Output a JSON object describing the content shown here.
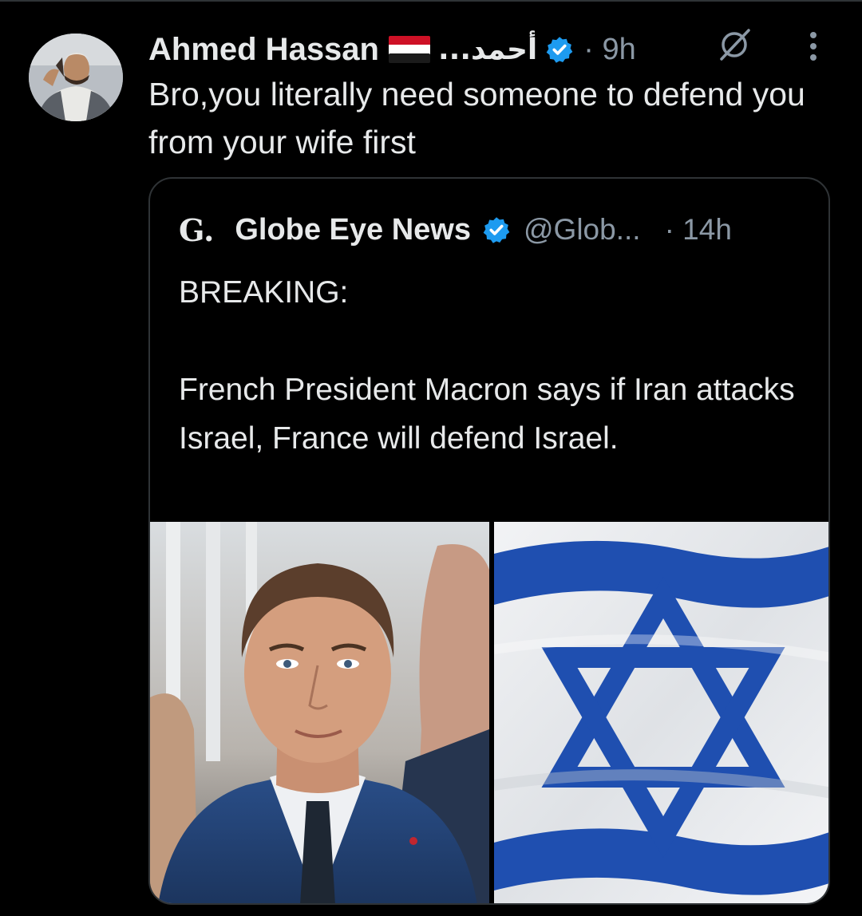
{
  "reply": {
    "author_name": "Ahmed Hassan",
    "author_arabic_name": "أحمد...",
    "flag_icon": "yemen-flag-icon",
    "verified_icon": "verified-badge-icon",
    "time": "· 9h",
    "text": "Bro,you literally need someone to defend you from your wife first"
  },
  "quoted": {
    "logo": "G.",
    "name": "Globe Eye News",
    "verified_icon": "verified-badge-icon",
    "handle": "@Glob...",
    "time": "· 14h",
    "text_lines": [
      "BREAKING:",
      "French President Macron says if Iran attacks Israel, France will defend Israel."
    ],
    "images": [
      "macron-photo",
      "israel-flag-image"
    ]
  },
  "colors": {
    "background": "#000000",
    "text": "#e7e9ea",
    "muted": "#8b98a5",
    "border": "#2f3336",
    "verified_blue": "#1d9bf0",
    "flag_blue": "#1f4fb0"
  }
}
